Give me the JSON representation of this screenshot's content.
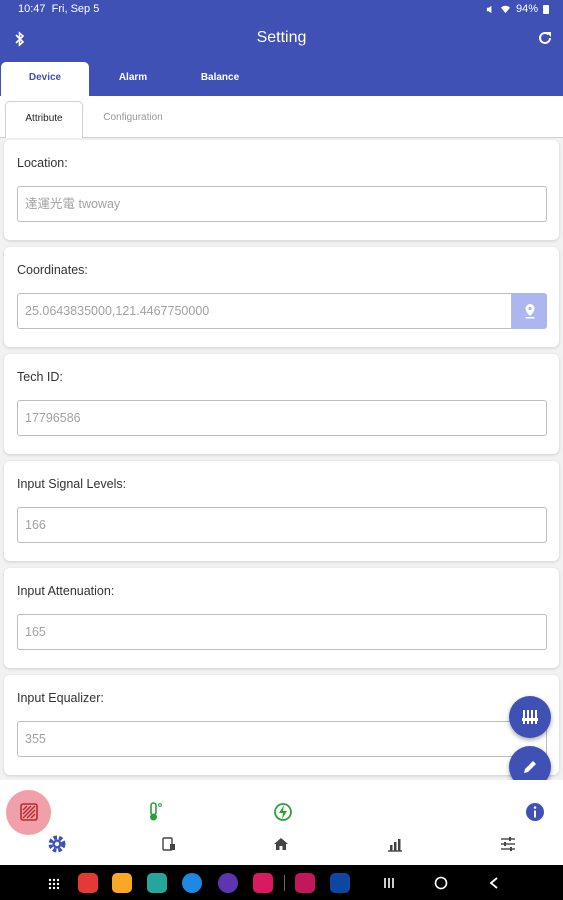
{
  "status_bar": {
    "time": "10:47",
    "date": "Fri, Sep 5",
    "battery": "94%"
  },
  "app_bar": {
    "title": "Setting"
  },
  "top_tabs": [
    {
      "label": "Device",
      "active": true
    },
    {
      "label": "Alarm",
      "active": false
    },
    {
      "label": "Balance",
      "active": false
    }
  ],
  "sub_tabs": [
    {
      "label": "Attribute",
      "active": true
    },
    {
      "label": "Configuration",
      "active": false
    }
  ],
  "fields": {
    "location": {
      "label": "Location:",
      "value": "達運光電 twoway"
    },
    "coordinates": {
      "label": "Coordinates:",
      "value": "25.0643835000,121.4467750000"
    },
    "tech_id": {
      "label": "Tech ID:",
      "value": "17796586"
    },
    "input_signal_levels": {
      "label": "Input Signal Levels:",
      "value": "166"
    },
    "input_attenuation": {
      "label": "Input Attenuation:",
      "value": "165"
    },
    "input_equalizer": {
      "label": "Input Equalizer:",
      "value": "355"
    }
  },
  "colors": {
    "primary": "#3f51b5",
    "green": "#2e9e3a",
    "pin_button": "#aeb6f0",
    "red_highlight": "#f0a0a8"
  },
  "bottom_nav_icons": [
    "signal-icon",
    "thermometer-icon",
    "power-icon",
    "info-icon",
    "settings-icon",
    "device-icon",
    "home-icon",
    "chart-icon",
    "sliders-icon"
  ]
}
